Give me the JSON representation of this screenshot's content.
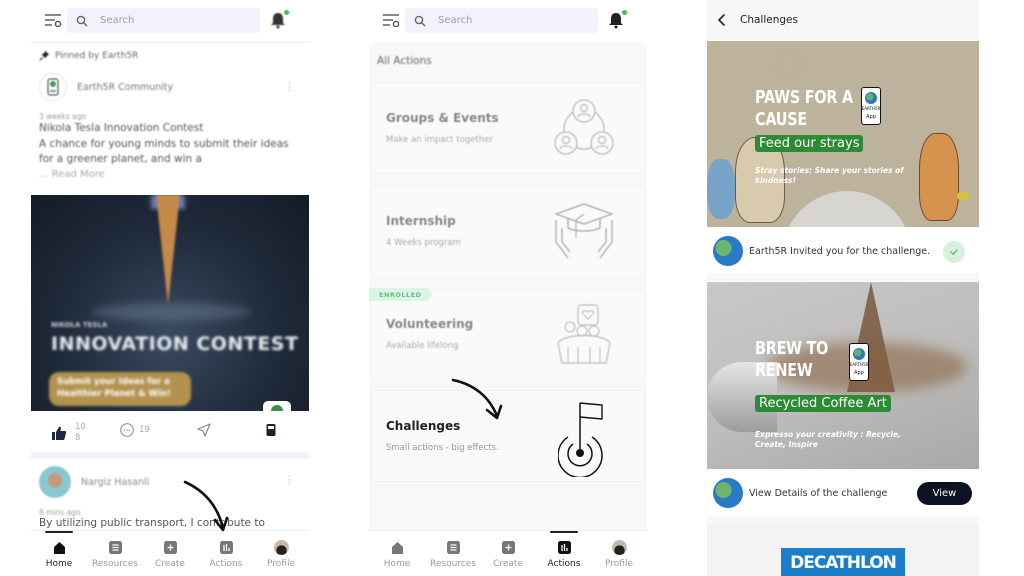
{
  "screens": {
    "home": {
      "search_placeholder": "Search",
      "pinned_label": "Pinned by Earth5R",
      "post1": {
        "author": "Earth5R Community",
        "time": "3 weeks ago",
        "title": "Nikola Tesla Innovation Contest",
        "body": "A chance for young minds to submit their ideas for a greener planet, and win a",
        "read_more": "... Read More",
        "image": {
          "small_text": "NIKOLA TESLA",
          "big_text": "INNOVATION CONTEST",
          "pill_text": "Submit your Ideas for a Healthier Planet & Win!"
        },
        "likes": "108",
        "likes_line1": "10",
        "likes_line2": "8",
        "comments": "19"
      },
      "post2": {
        "author": "Nargiz Hasanli",
        "time": "8 mins ago",
        "text": "By utilizing public transport, I contribute to"
      }
    },
    "actions": {
      "search_placeholder": "Search",
      "section_title": "All Actions",
      "cards": [
        {
          "title": "Groups & Events",
          "subtitle": "Make an impact together",
          "icon": "groups-icon"
        },
        {
          "title": "Internship",
          "subtitle": "4 Weeks program",
          "icon": "graduation-cap-icon"
        },
        {
          "title": "Volunteering",
          "subtitle": "Available lifelong",
          "icon": "volunteer-hands-icon",
          "badge": "ENROLLED"
        },
        {
          "title": "Challenges",
          "subtitle": "Small actions - big effects.",
          "icon": "target-flag-icon"
        }
      ]
    },
    "challenges": {
      "header_title": "Challenges",
      "items": [
        {
          "banner_title_line1": "PAWS FOR A",
          "banner_title_line2": "CAUSE",
          "banner_highlight": "Feed our strays",
          "banner_sub_line1": "Stray stories: Share your stories of",
          "banner_sub_line2": "kindness!",
          "badge_brand": "EARTH5R",
          "badge_app": "App",
          "info_text": "Earth5R Invited you for the challenge.",
          "status": "accepted"
        },
        {
          "banner_title_line1": "BREW TO",
          "banner_title_line2": "RENEW",
          "banner_highlight": "Recycled Coffee Art",
          "banner_sub_line1": "Expresso your creativity : Recycle,",
          "banner_sub_line2": "Create,  Inspire",
          "badge_brand": "EARTH5R",
          "badge_app": "App",
          "info_text": "View Details of the challenge",
          "button_label": "View"
        }
      ],
      "sponsor": "DECATHLON"
    }
  },
  "bottom_nav": {
    "items": [
      {
        "label": "Home",
        "icon": "home-icon"
      },
      {
        "label": "Resources",
        "icon": "resources-icon"
      },
      {
        "label": "Create",
        "icon": "plus-square-icon"
      },
      {
        "label": "Actions",
        "icon": "actions-chart-icon"
      },
      {
        "label": "Profile",
        "icon": "profile-avatar"
      }
    ],
    "active_home_screen": "Home",
    "active_actions_screen": "Actions"
  },
  "colors": {
    "accent_green": "#2e8b35",
    "enrolled_bg": "#d8f6e3",
    "view_button": "#0c1221",
    "search_bg": "#f2f3fa",
    "notification_dot": "#3fc25b",
    "decathlon_blue": "#1a7ec8"
  }
}
